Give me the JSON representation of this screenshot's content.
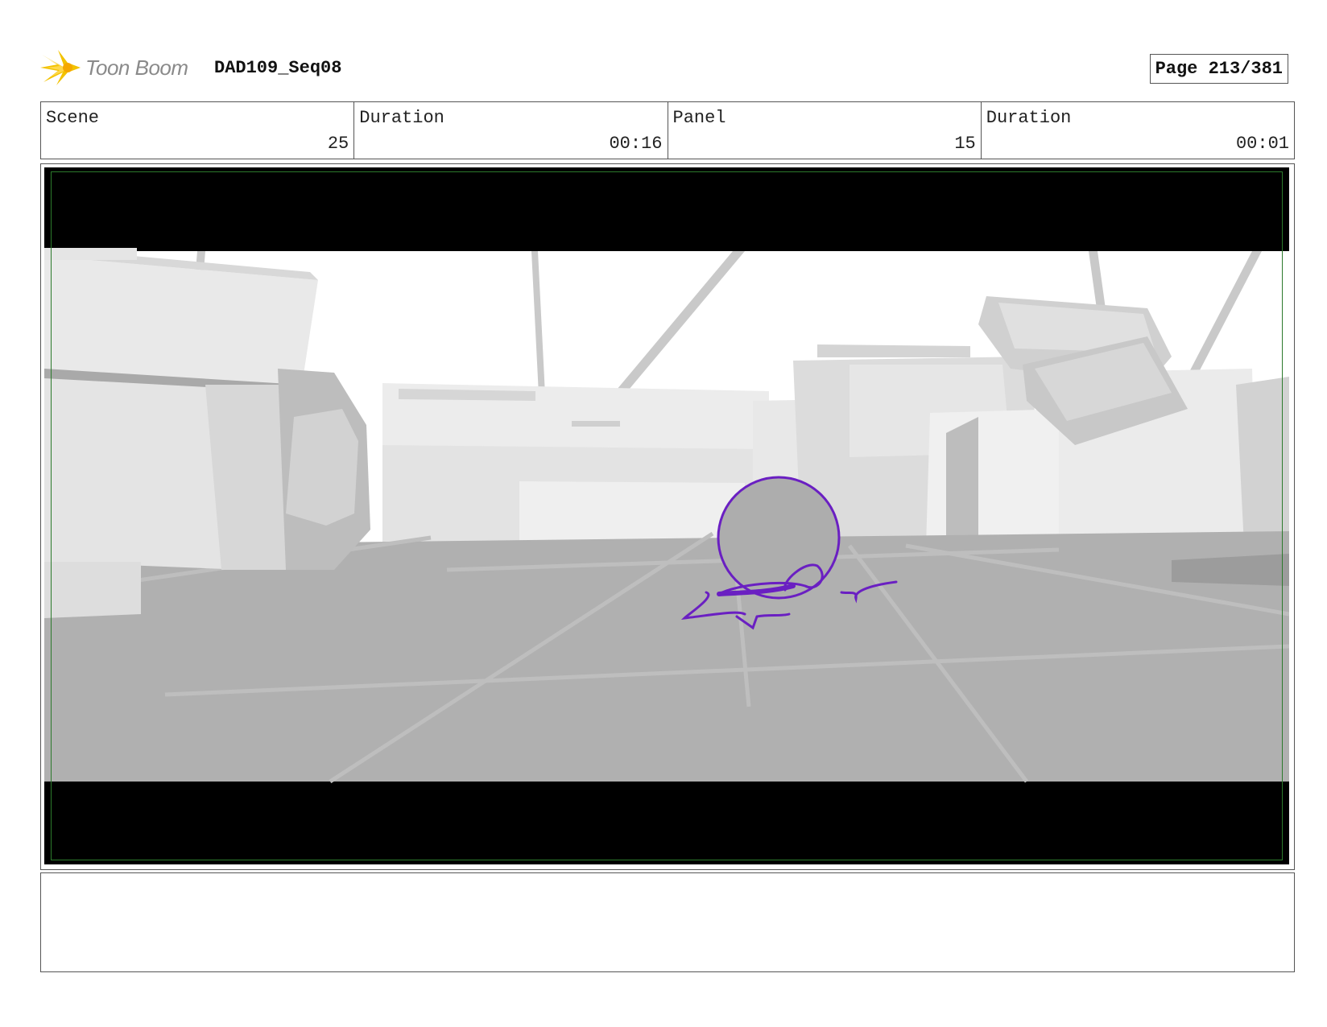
{
  "header": {
    "logo_text": "Toon Boom",
    "sequence_title": "DAD109_Seq08",
    "page_label": "Page 213/381"
  },
  "info": {
    "scene_label": "Scene",
    "scene_value": "25",
    "scene_duration_label": "Duration",
    "scene_duration_value": "00:16",
    "panel_label": "Panel",
    "panel_value": "15",
    "panel_duration_label": "Duration",
    "panel_duration_value": "00:01"
  },
  "panel": {
    "sketch_color": "#6a1fc2",
    "safe_frame_color": "#2c7a2c"
  },
  "notes": {
    "text": ""
  }
}
